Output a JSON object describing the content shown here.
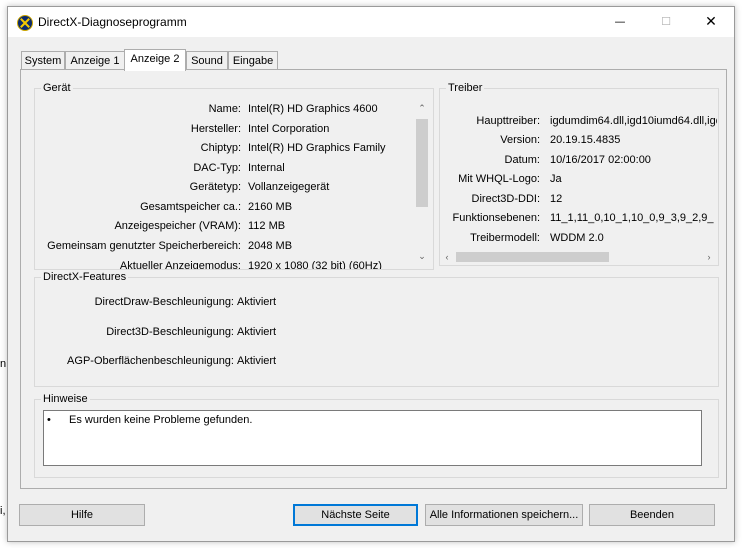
{
  "window": {
    "title": "DirectX-Diagnoseprogramm"
  },
  "titlebar_buttons": {
    "minimize": "—",
    "maximize": "☐",
    "close": "✕"
  },
  "tabs": [
    {
      "label": "System"
    },
    {
      "label": "Anzeige 1"
    },
    {
      "label": "Anzeige 2"
    },
    {
      "label": "Sound"
    },
    {
      "label": "Eingabe"
    }
  ],
  "active_tab": "Anzeige 2",
  "device": {
    "label": "Gerät",
    "rows": [
      {
        "key": "Name:",
        "value": "Intel(R) HD Graphics 4600"
      },
      {
        "key": "Hersteller:",
        "value": "Intel Corporation"
      },
      {
        "key": "Chiptyp:",
        "value": "Intel(R) HD Graphics Family"
      },
      {
        "key": "DAC-Typ:",
        "value": "Internal"
      },
      {
        "key": "Gerätetyp:",
        "value": "Vollanzeigegerät"
      },
      {
        "key": "Gesamtspeicher ca.:",
        "value": "2160 MB"
      },
      {
        "key": "Anzeigespeicher (VRAM):",
        "value": "112 MB"
      },
      {
        "key": "Gemeinsam genutzter Speicherbereich:",
        "value": "2048 MB"
      },
      {
        "key": "Aktueller Anzeigemodus:",
        "value": "1920 x 1080 (32 bit) (60Hz)"
      }
    ]
  },
  "driver": {
    "label": "Treiber",
    "rows": [
      {
        "key": "Haupttreiber:",
        "value": "igdumdim64.dll,igd10iumd64.dll,igd"
      },
      {
        "key": "Version:",
        "value": "20.19.15.4835"
      },
      {
        "key": "Datum:",
        "value": "10/16/2017 02:00:00"
      },
      {
        "key": "Mit WHQL-Logo:",
        "value": "Ja"
      },
      {
        "key": "Direct3D-DDI:",
        "value": "12"
      },
      {
        "key": "Funktionsebenen:",
        "value": "11_1,11_0,10_1,10_0,9_3,9_2,9_"
      },
      {
        "key": "Treibermodell:",
        "value": "WDDM 2.0"
      }
    ]
  },
  "features": {
    "label": "DirectX-Features",
    "rows": [
      {
        "key": "DirectDraw-Beschleunigung:",
        "value": "Aktiviert"
      },
      {
        "key": "Direct3D-Beschleunigung:",
        "value": "Aktiviert"
      },
      {
        "key": "AGP-Oberflächenbeschleunigung:",
        "value": "Aktiviert"
      }
    ]
  },
  "notes": {
    "label": "Hinweise",
    "items": [
      "Es wurden keine Probleme gefunden."
    ]
  },
  "buttons": {
    "help": "Hilfe",
    "next_page": "Nächste Seite",
    "save_all": "Alle Informationen speichern...",
    "exit": "Beenden"
  },
  "background_fragments": [
    "n",
    "i,"
  ],
  "icons": [
    "directx-app-icon",
    "scroll-up-icon",
    "scroll-down-icon",
    "scroll-left-icon",
    "scroll-right-icon",
    "bullet-icon"
  ],
  "colors": {
    "window_bg": "#f0f0f0",
    "button_bg": "#e1e1e1",
    "default_button_border": "#0078d7",
    "scroll_thumb": "#cdcdcd"
  }
}
